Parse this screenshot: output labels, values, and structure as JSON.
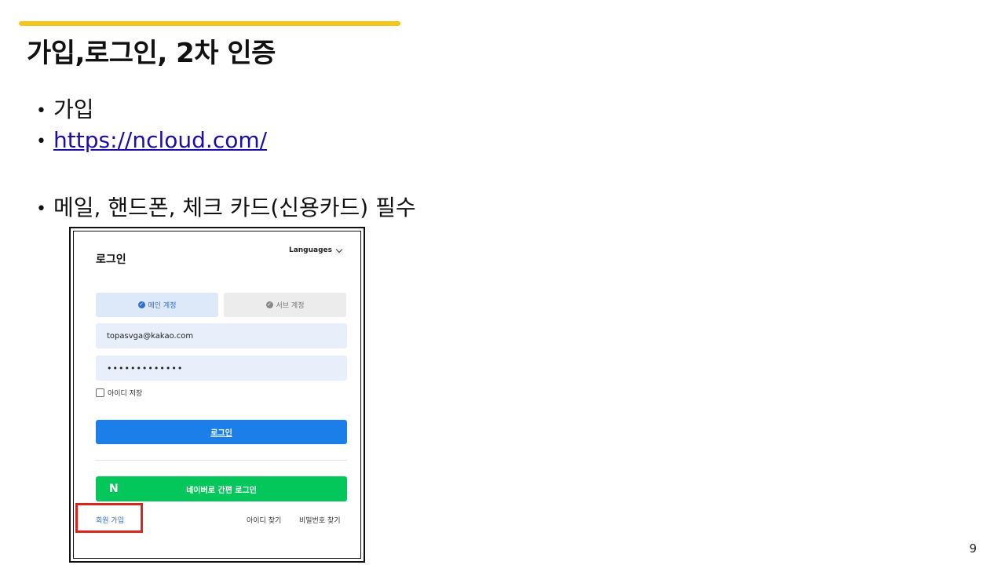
{
  "slide": {
    "title": "가입,로그인, 2차 인증",
    "bullets": [
      "가입",
      "https://ncloud.com/",
      "메일, 핸드폰, 체크 카드(신용카드) 필수"
    ],
    "page_number": "9",
    "accent_color": "#f5c518"
  },
  "screenshot": {
    "heading": "로그인",
    "languages_label": "Languages",
    "tabs": [
      {
        "label": "메인 계정",
        "selected": true
      },
      {
        "label": "서브 계정",
        "selected": false
      }
    ],
    "email_value": "topasvga@kakao.com",
    "password_mask": "•••••••••••••",
    "remember_label": "아이디 저장",
    "login_button": "로그인",
    "naver_button": "네이버로 간편 로그인",
    "naver_logo": "N",
    "signup_link": "회원 가입",
    "find_id_link": "아이디 찾기",
    "find_pw_link": "비밀번호 찾기",
    "colors": {
      "login_button": "#1c7ee8",
      "naver_button": "#03c75a",
      "highlight": "#d9261c"
    }
  }
}
